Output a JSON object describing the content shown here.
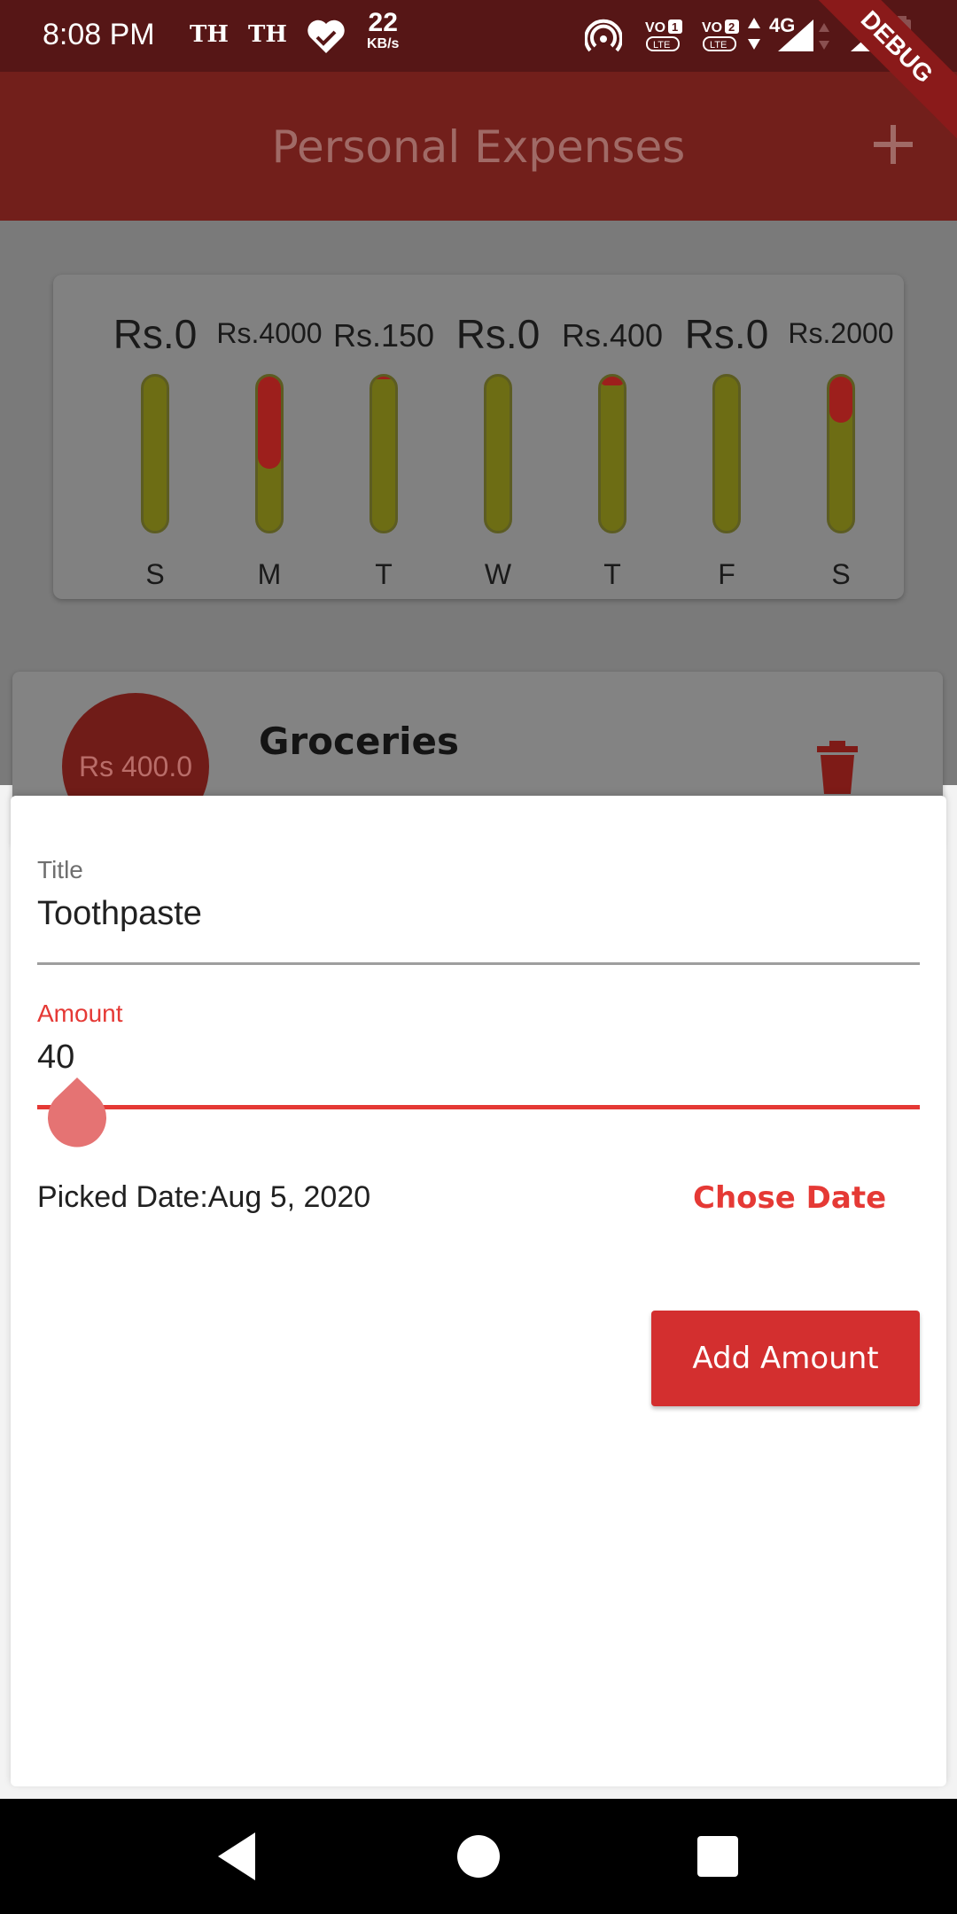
{
  "status_bar": {
    "time": "8:08 PM",
    "carrier_1": "TH",
    "carrier_2": "TH",
    "speed_value": "22",
    "speed_unit": "KB/s",
    "network": "4G",
    "debug_label": "DEBUG",
    "icons": [
      "heart-check-icon",
      "hotspot-icon",
      "volte-1-icon",
      "volte-2-icon",
      "signal-icon",
      "battery-icon"
    ]
  },
  "app_bar": {
    "title": "Personal Expenses",
    "add_icon": "plus-icon"
  },
  "chart": {
    "bars": [
      {
        "day": "S",
        "amount": "Rs.0",
        "fill": 0.0
      },
      {
        "day": "M",
        "amount": "Rs.4000",
        "fill": 0.6
      },
      {
        "day": "T",
        "amount": "Rs.150",
        "fill": 0.02
      },
      {
        "day": "W",
        "amount": "Rs.0",
        "fill": 0.0
      },
      {
        "day": "T",
        "amount": "Rs.400",
        "fill": 0.06
      },
      {
        "day": "F",
        "amount": "Rs.0",
        "fill": 0.0
      },
      {
        "day": "S",
        "amount": "Rs.2000",
        "fill": 0.3
      }
    ]
  },
  "transaction": {
    "amount": "Rs 400.0",
    "title": "Groceries",
    "delete_icon": "trash-icon"
  },
  "form": {
    "title_label": "Title",
    "title_value": "Toothpaste",
    "amount_label": "Amount",
    "amount_value": "40",
    "picked_date": "Picked Date:Aug 5, 2020",
    "chose_date_label": "Chose Date",
    "submit_label": "Add Amount"
  },
  "nav": {
    "back_icon": "back-triangle-icon",
    "home_icon": "home-circle-icon",
    "recents_icon": "recents-square-icon"
  },
  "colors": {
    "accent": "#e53935",
    "primary_dark": "#561616",
    "button": "#d32f2f"
  }
}
